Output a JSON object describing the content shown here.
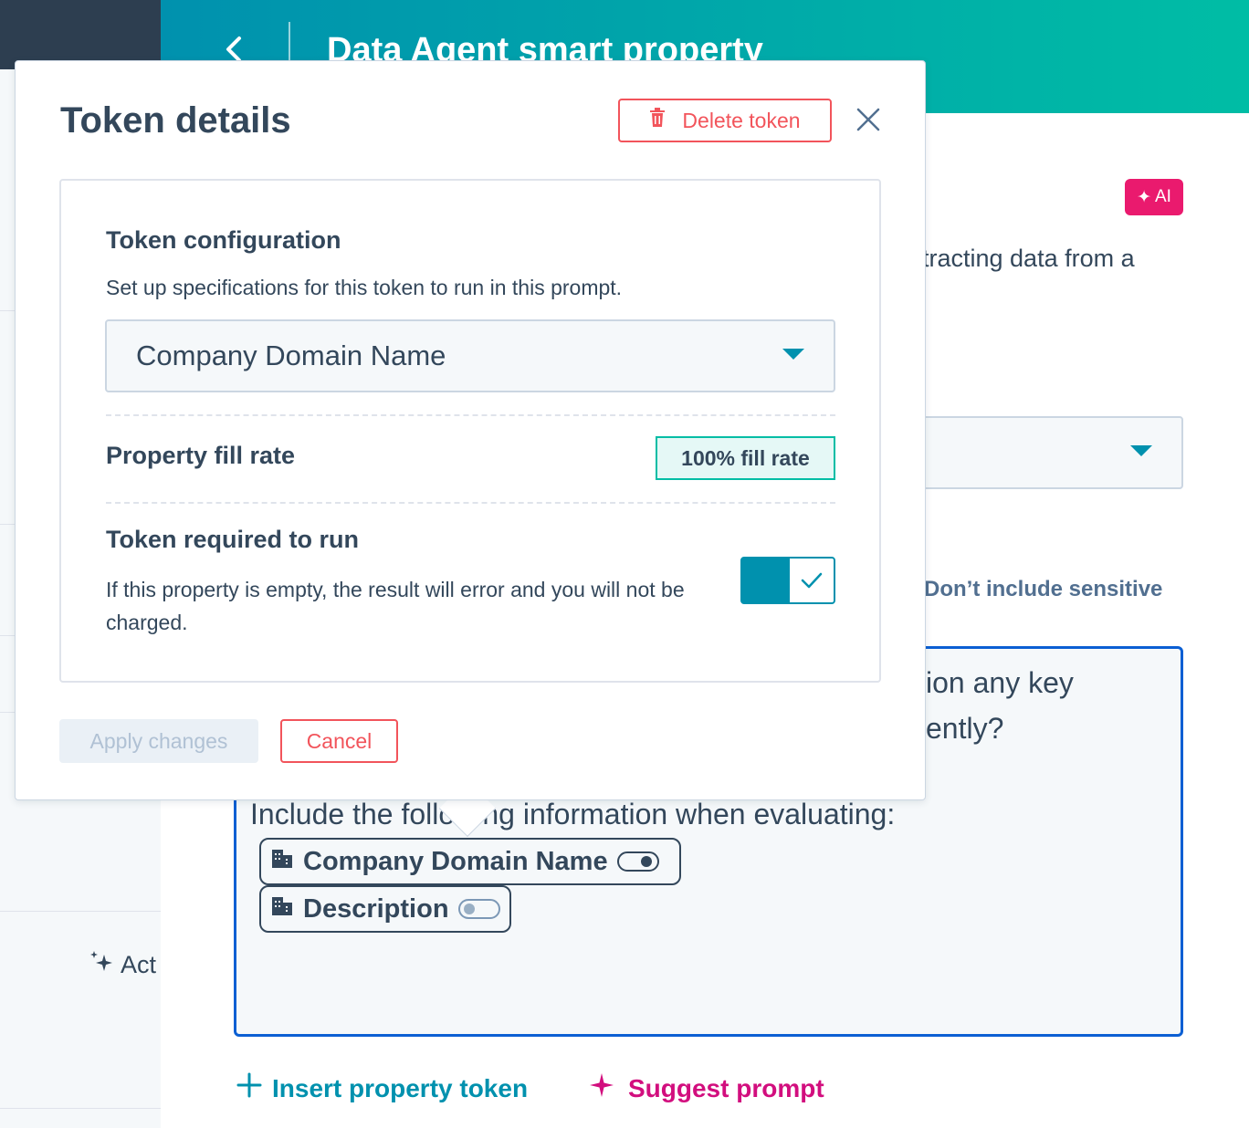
{
  "header": {
    "title": "Data Agent smart property",
    "back_icon": "chevron-left-icon"
  },
  "background": {
    "ai_badge": "AI",
    "partial_description": "tracting data from a",
    "sensitive_note": "Don’t include sensitive",
    "prompt": {
      "partial_line_1": "ion any key",
      "partial_line_2": "ently?",
      "line": "Include the following information when evaluating:",
      "tokens": [
        {
          "label": "Company Domain Name",
          "required": true
        },
        {
          "label": "Description",
          "required": false
        }
      ]
    },
    "insert_token_label": "Insert property token",
    "suggest_prompt_label": "Suggest prompt",
    "sidebar_action_label": "Act"
  },
  "modal": {
    "title": "Token details",
    "delete_label": "Delete token",
    "config": {
      "title": "Token configuration",
      "description": "Set up specifications for this token to run in this prompt.",
      "selected_property": "Company Domain Name"
    },
    "fill_rate": {
      "label": "Property fill rate",
      "badge": "100% fill rate"
    },
    "required": {
      "label": "Token required to run",
      "description": "If this property is empty, the result will error and you will not be charged.",
      "enabled": true
    },
    "apply_label": "Apply changes",
    "cancel_label": "Cancel"
  },
  "colors": {
    "accent": "#0091ae",
    "danger": "#f2545b",
    "ai_pink": "#ea1a6e",
    "text": "#33475b"
  }
}
